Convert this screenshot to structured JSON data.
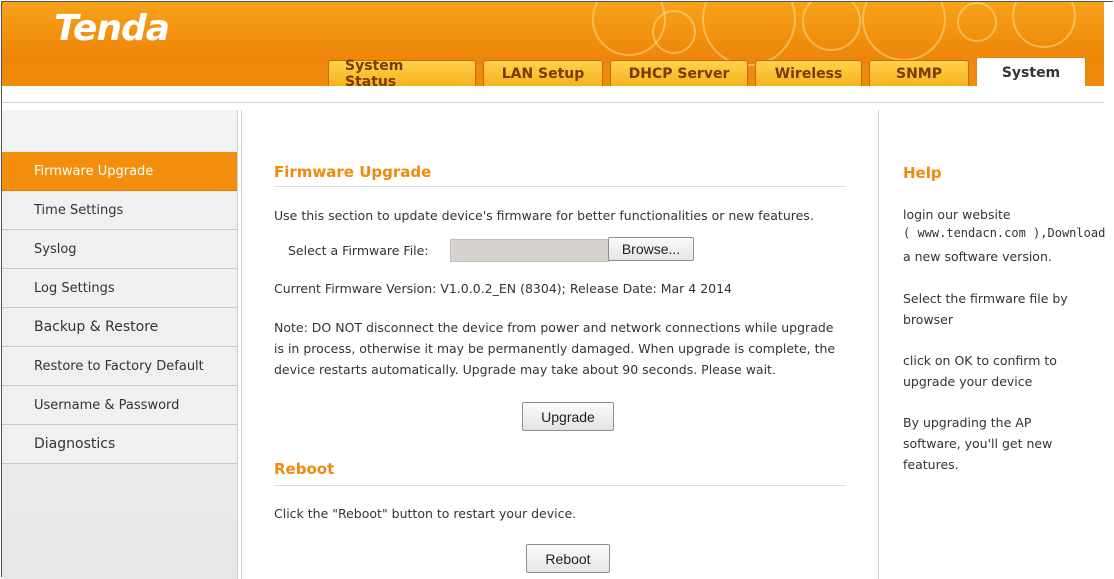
{
  "brand": {
    "logo": "Tenda"
  },
  "tabs": [
    {
      "label": "System Status"
    },
    {
      "label": "LAN Setup"
    },
    {
      "label": "DHCP Server"
    },
    {
      "label": "Wireless"
    },
    {
      "label": "SNMP"
    },
    {
      "label": "System"
    }
  ],
  "active_tab": "System",
  "sidebar": {
    "items": [
      {
        "label": "Firmware Upgrade"
      },
      {
        "label": "Time Settings"
      },
      {
        "label": "Syslog"
      },
      {
        "label": "Log Settings"
      },
      {
        "label": "Backup & Restore"
      },
      {
        "label": "Restore to Factory Default"
      },
      {
        "label": "Username & Password"
      },
      {
        "label": "Diagnostics"
      }
    ],
    "active": "Firmware Upgrade"
  },
  "firmware": {
    "title": "Firmware Upgrade",
    "intro": "Use this section to update device's firmware for better functionalities or new features.",
    "file_label": "Select a Firmware File:",
    "browse_label": "Browse...",
    "version_text": "Current Firmware Version: V1.0.0.2_EN (8304); Release Date: Mar 4 2014",
    "note_line1": "Note: DO NOT disconnect the device from power and network connections while upgrade",
    "note_line2": "is in process, otherwise it may be permanently damaged. When upgrade is complete, the",
    "note_line3": "device restarts automatically. Upgrade may take about 90 seconds. Please wait.",
    "upgrade_label": "Upgrade"
  },
  "reboot": {
    "title": "Reboot",
    "text": "Click the \"Reboot\" button to restart your device.",
    "button_label": "Reboot"
  },
  "help": {
    "title": "Help",
    "p1_line1": "login our website",
    "p1_line2": "( www.tendacn.com ),Download",
    "p1_line3": "a new software version.",
    "p2_line1": "Select the firmware file by",
    "p2_line2": "browser",
    "p3_line1": "click on OK to confirm to",
    "p3_line2": "upgrade your device",
    "p4_line1": "By upgrading the AP",
    "p4_line2": "software, you'll get new",
    "p4_line3": "features."
  },
  "colors": {
    "accent": "#f08a0c",
    "active_item": "#f48f0e"
  }
}
